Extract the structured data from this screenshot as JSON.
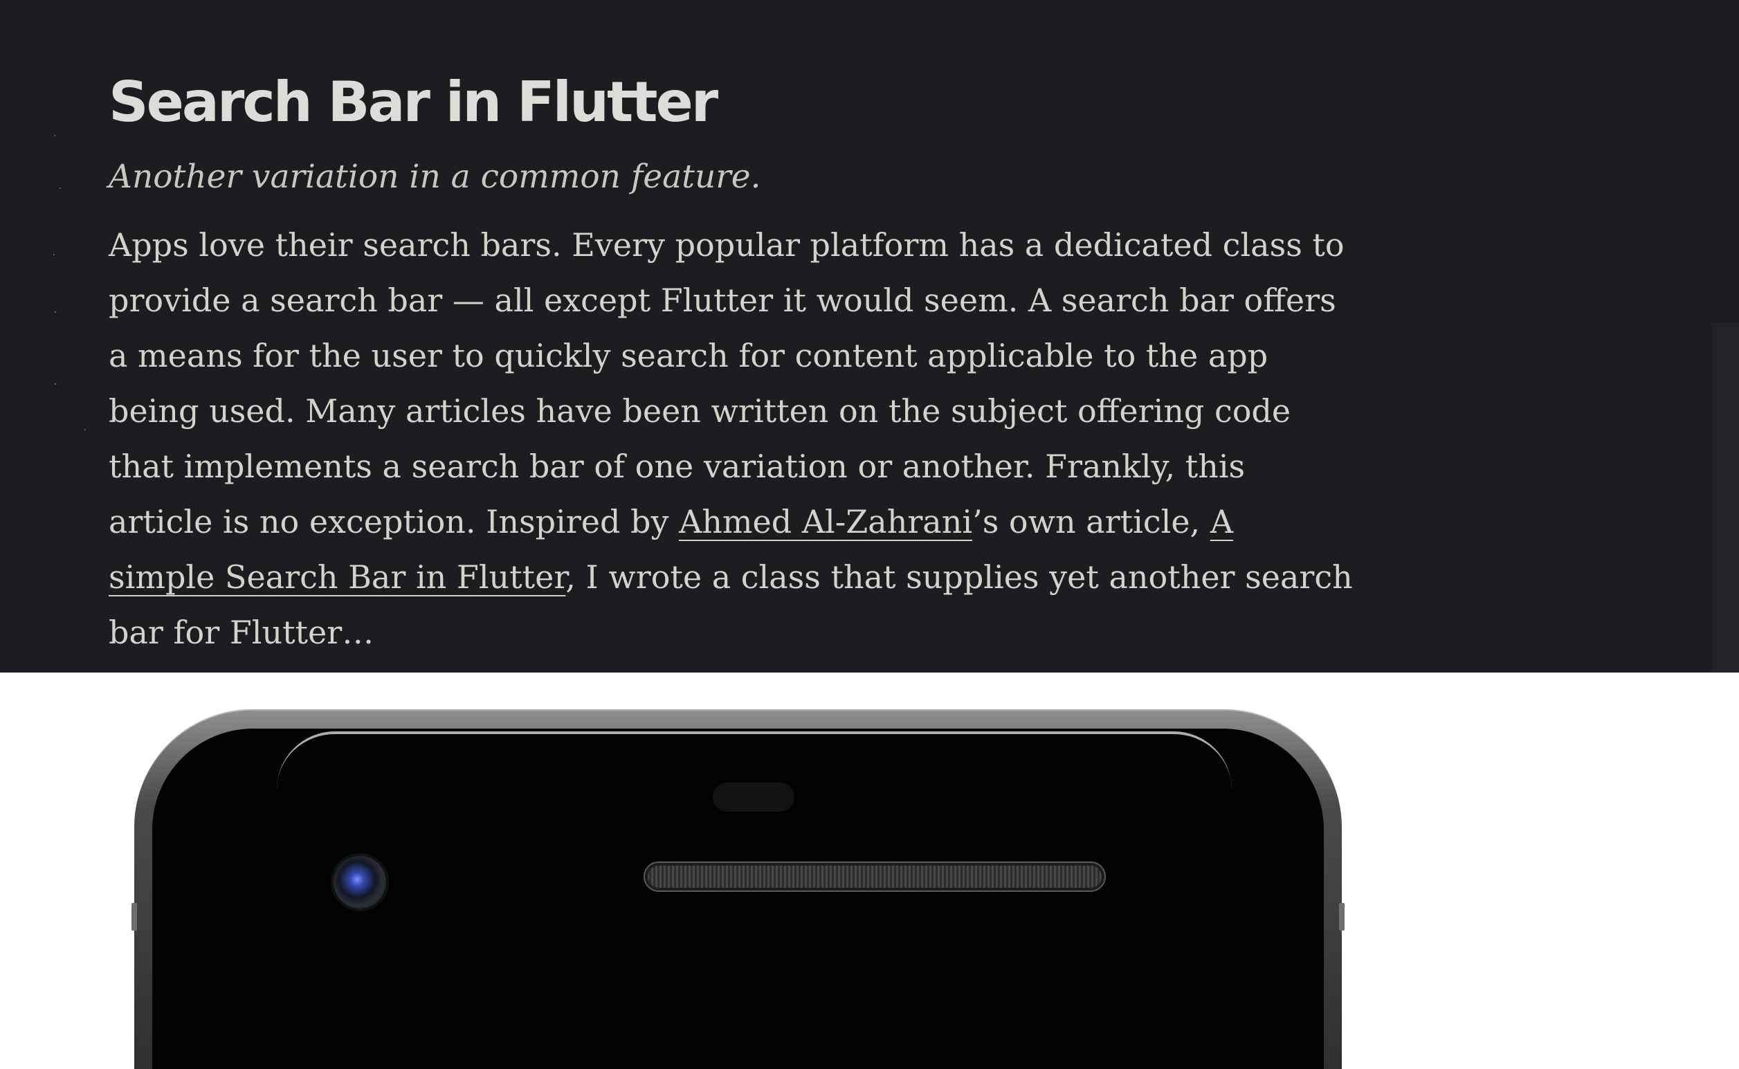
{
  "article": {
    "title": "Search Bar in Flutter",
    "subtitle": "Another variation in a common feature.",
    "excerpt": {
      "line1": "Apps love their search bars. Every popular platform has a dedicated class to",
      "line2": "provide a search bar — all except Flutter it would seem. A search bar offers",
      "line3": "a means for the user to quickly search for content applicable to the app",
      "line4": "being used. Many articles have been written on the subject offering code",
      "line5": "that implements a search bar of one variation or another. Frankly, this",
      "line6_before": "article is no exception. Inspired by ",
      "author_link": "Ahmed Al-Zahrani",
      "line6_middle": "’s own article, ",
      "article_link_part1": "A",
      "article_link_part2": "simple Search Bar in Flutter",
      "line7_after": ", I wrote a class that supplies yet another search",
      "line8": "bar for Flutter…"
    }
  },
  "colors": {
    "article_background": "#1c1d20",
    "title_text": "#dedcd8",
    "body_text": "#d5d2cc",
    "page_background": "#ffffff"
  },
  "icons": {
    "device": "phone-preview-icon",
    "camera": "camera-icon",
    "speaker": "speaker-icon"
  }
}
